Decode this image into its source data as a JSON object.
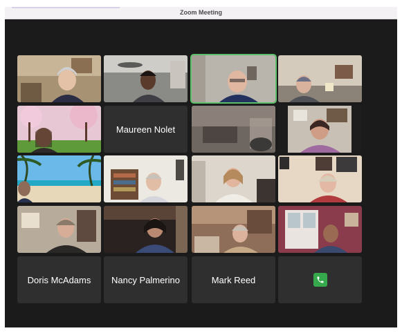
{
  "window": {
    "title": "Zoom Meeting"
  },
  "colors": {
    "active_speaker_border": "#5dc06a",
    "call_button": "#37a94d",
    "background": "#1b1b1b"
  },
  "participants_with_names": [
    {
      "name": "Maureen Nolet"
    },
    {
      "name": "Doris McAdams"
    },
    {
      "name": "Nancy Palmerino"
    },
    {
      "name": "Mark Reed"
    }
  ],
  "call_control": {
    "icon": "phone-icon"
  }
}
